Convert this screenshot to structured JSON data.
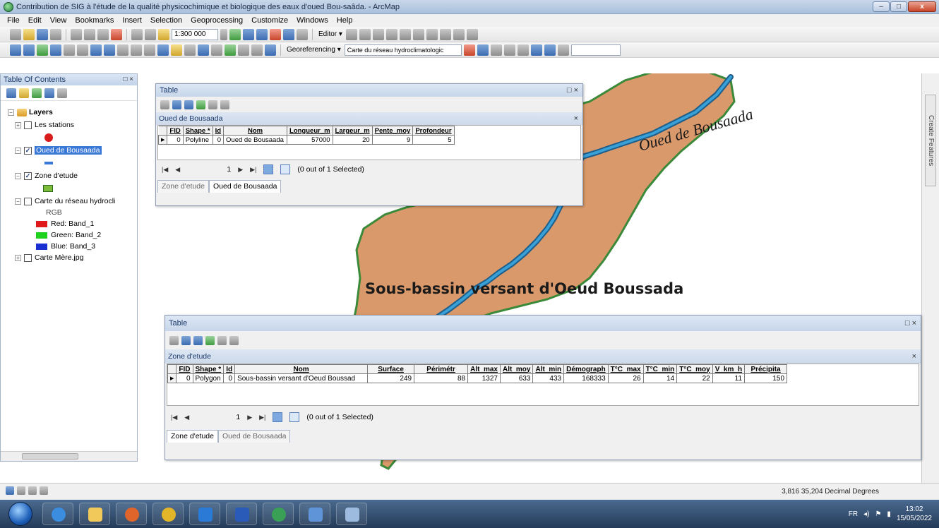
{
  "window": {
    "title": "Contribution de SIG à l'étude de la qualité physicochimique et biologique des eaux d'oued  Bou-saâda. - ArcMap"
  },
  "menu": [
    "File",
    "Edit",
    "View",
    "Bookmarks",
    "Insert",
    "Selection",
    "Geoprocessing",
    "Customize",
    "Windows",
    "Help"
  ],
  "toolbar": {
    "scale": "1:300 000",
    "editor_label": "Editor ▾",
    "georef_label": "Georeferencing ▾",
    "georef_layer": "Carte du réseau hydroclimatologic"
  },
  "toc": {
    "title": "Table Of Contents",
    "layers_group": "Layers",
    "layer_stations": "Les stations",
    "layer_oued": "Oued de Bousaada",
    "layer_zone": "Zone d'etude",
    "layer_carte": "Carte du réseau hydrocli",
    "rgb": "RGB",
    "band_red": "Red:  Band_1",
    "band_green": "Green: Band_2",
    "band_blue": "Blue:  Band_3",
    "layer_mere": "Carte Mère.jpg"
  },
  "map": {
    "river_label": "Oued de Bousaada",
    "basin_label": "Sous-bassin versant d'Oeud Boussada",
    "colors": {
      "basin": "#d9996a",
      "river": "#3aa0d8",
      "outline": "#3a8a3a"
    }
  },
  "table1": {
    "title": "Table",
    "layer": "Oued de Bousaada",
    "columns": [
      "FID",
      "Shape *",
      "Id",
      "Nom",
      "Longueur_m",
      "Largeur_m",
      "Pente_moy",
      "Profondeur"
    ],
    "row": [
      "0",
      "Polyline",
      "0",
      "Oued de Bousaada",
      "57000",
      "20",
      "9",
      "5"
    ],
    "nav_record": "1",
    "selected": "(0 out of 1 Selected)",
    "tab1": "Zone d'etude",
    "tab2": "Oued de Bousaada"
  },
  "table2": {
    "title": "Table",
    "layer": "Zone d'etude",
    "columns": [
      "FID",
      "Shape *",
      "Id",
      "Nom",
      "Surface",
      "Périmétr",
      "Alt_max",
      "Alt_moy",
      "Alt_min",
      "Démograph",
      "T°C_max",
      "T°C_min",
      "T°C_moy",
      "V_km_h",
      "Précipita"
    ],
    "row": [
      "0",
      "Polygon",
      "0",
      "Sous-bassin versant d'Oeud Boussad",
      "249",
      "88",
      "1327",
      "633",
      "433",
      "168333",
      "26",
      "14",
      "22",
      "11",
      "150"
    ],
    "nav_record": "1",
    "selected": "(0 out of 1 Selected)",
    "tab1": "Zone d'etude",
    "tab2": "Oued de Bousaada"
  },
  "rdock": {
    "tab": "Create Features"
  },
  "status": {
    "coords": "3,816  35,204 Decimal Degrees"
  },
  "tray": {
    "lang": "FR",
    "time": "13:02",
    "date": "15/05/2022"
  }
}
